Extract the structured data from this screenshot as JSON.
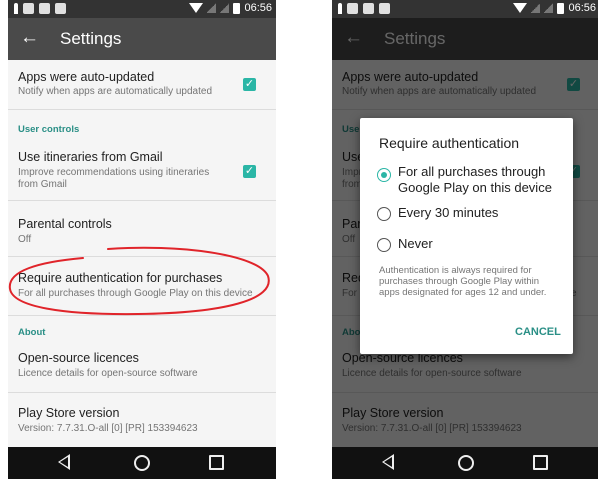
{
  "statusbar": {
    "time": "06:56"
  },
  "toolbar": {
    "title": "Settings"
  },
  "settings": {
    "auto_update_title": "Apps were auto-updated",
    "auto_update_sub": "Notify when apps are automatically updated",
    "auto_update_checked": true,
    "user_controls_header": "User controls",
    "itineraries_title": "Use itineraries from Gmail",
    "itineraries_sub_line1": "Improve recommendations using itineraries",
    "itineraries_sub_line2": "from Gmail",
    "itineraries_checked": true,
    "parental_title": "Parental controls",
    "parental_sub": "Off",
    "auth_title": "Require authentication for purchases",
    "auth_sub": "For all purchases through Google Play on this device",
    "about_header": "About",
    "licences_title": "Open-source licences",
    "licences_sub": "Licence details for open-source software",
    "version_title": "Play Store version",
    "version_sub": "Version: 7.7.31.O-all [0] [PR] 153394623"
  },
  "dialog": {
    "title": "Require authentication",
    "options": [
      {
        "line1": "For all purchases through",
        "line2": "Google Play on this device",
        "selected": true
      },
      {
        "line1": "Every 30 minutes",
        "selected": false
      },
      {
        "line1": "Never",
        "selected": false
      }
    ],
    "note": "Authentication is always required for purchases through Google Play within apps designated for ages 12 and under.",
    "cancel_label": "CANCEL"
  },
  "colors": {
    "accent": "#2bb6a6",
    "section_header": "#2a8f86",
    "toolbar": "#4a4a4a",
    "status_bar": "#333333",
    "nav_bar": "#111111",
    "annotation_circle": "#e0242a"
  }
}
